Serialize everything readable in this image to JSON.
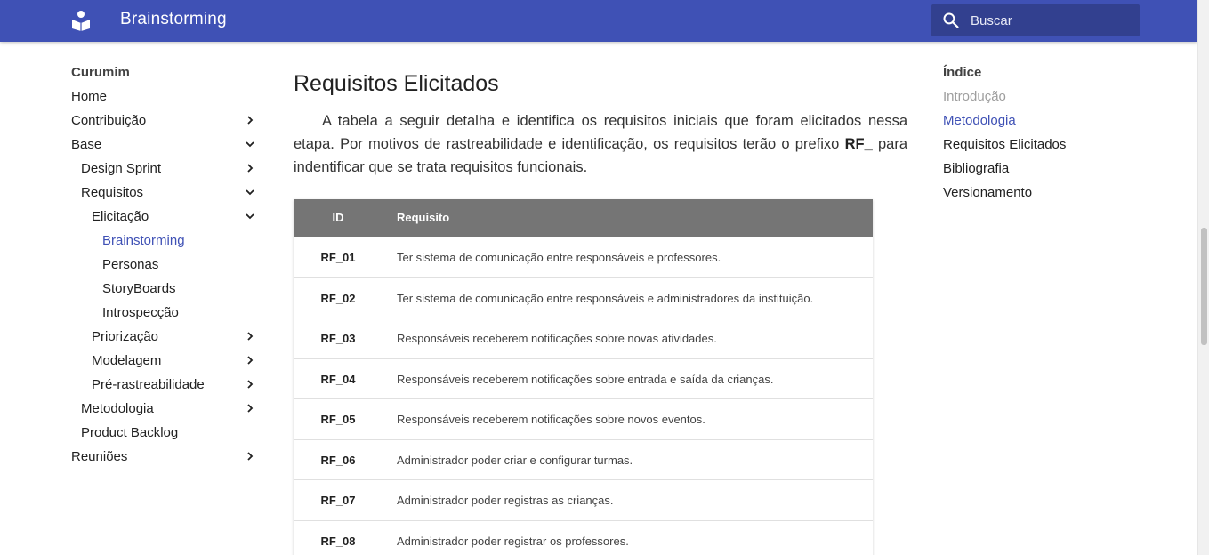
{
  "header": {
    "title": "Brainstorming",
    "search_placeholder": "Buscar",
    "brand_color": "#3f51b5"
  },
  "nav": {
    "title": "Curumim",
    "items": [
      {
        "label": "Home"
      },
      {
        "label": "Contribuição"
      },
      {
        "label": "Base"
      },
      {
        "label": "Design Sprint"
      },
      {
        "label": "Requisitos"
      },
      {
        "label": "Elicitação"
      },
      {
        "label": "Brainstorming"
      },
      {
        "label": "Personas"
      },
      {
        "label": "StoryBoards"
      },
      {
        "label": "Introspecção"
      },
      {
        "label": "Priorização"
      },
      {
        "label": "Modelagem"
      },
      {
        "label": "Pré-rastreabilidade"
      },
      {
        "label": "Metodologia"
      },
      {
        "label": "Product Backlog"
      },
      {
        "label": "Reuniões"
      }
    ]
  },
  "main": {
    "heading": "Requisitos Elicitados",
    "intro_before": "A tabela a seguir detalha e identifica os requisitos iniciais que foram elicitados nessa etapa. Por motivos de rastreabilidade e identificação, os requisitos terão o prefixo ",
    "intro_bold": "RF_",
    "intro_after": " para indentificar que se trata requisitos funcionais.",
    "table": {
      "headers": [
        "ID",
        "Requisito"
      ],
      "rows": [
        {
          "id": "RF_01",
          "text": "Ter sistema de comunicação entre responsáveis e professores."
        },
        {
          "id": "RF_02",
          "text": "Ter sistema de comunicação entre responsáveis e administradores da instituição."
        },
        {
          "id": "RF_03",
          "text": "Responsáveis receberem notificações sobre novas atividades."
        },
        {
          "id": "RF_04",
          "text": "Responsáveis receberem notificações sobre entrada e saída da crianças."
        },
        {
          "id": "RF_05",
          "text": "Responsáveis receberem notificações sobre novos eventos."
        },
        {
          "id": "RF_06",
          "text": "Administrador poder criar e configurar turmas."
        },
        {
          "id": "RF_07",
          "text": "Administrador poder registras as crianças."
        },
        {
          "id": "RF_08",
          "text": "Administrador poder registrar os professores."
        }
      ]
    }
  },
  "toc": {
    "title": "Índice",
    "items": [
      {
        "label": "Introdução"
      },
      {
        "label": "Metodologia"
      },
      {
        "label": "Requisitos Elicitados"
      },
      {
        "label": "Bibliografia"
      },
      {
        "label": "Versionamento"
      }
    ]
  }
}
